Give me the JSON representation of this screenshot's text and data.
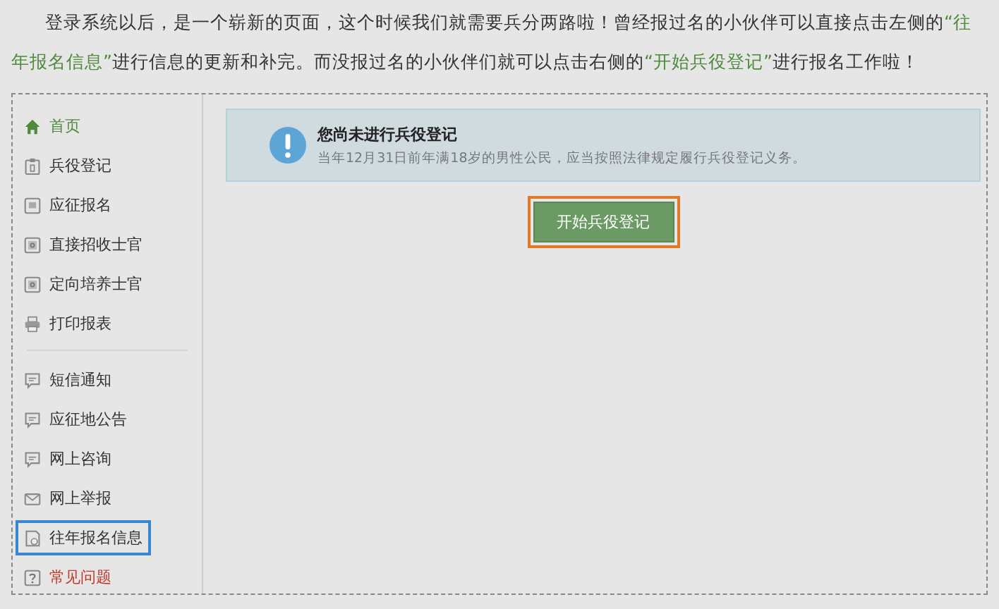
{
  "intro": [
    {
      "text": "登录系统以后，是一个崭新的页面，这个时候我们就需要兵分两路啦！曾经报过名的小伙伴可以直接点击左侧的",
      "highlight": false
    },
    {
      "text": "“往年报名信息”",
      "highlight": true
    },
    {
      "text": "进行信息的更新和补完。而没报过名的小伙伴们就可以点击右侧的",
      "highlight": false
    },
    {
      "text": "“开始兵役登记”",
      "highlight": true
    },
    {
      "text": "进行报名工作啦！",
      "highlight": false
    }
  ],
  "sidebar": {
    "groups": [
      {
        "items": [
          {
            "label": "首页",
            "kind": "home",
            "color": "#4f8a3c",
            "outlined": false
          },
          {
            "label": "兵役登记",
            "kind": "clipboard",
            "color": "#333333",
            "outlined": false
          },
          {
            "label": "应征报名",
            "kind": "form",
            "color": "#333333",
            "outlined": false
          },
          {
            "label": "直接招收士官",
            "kind": "badge",
            "color": "#333333",
            "outlined": false
          },
          {
            "label": "定向培养士官",
            "kind": "badge",
            "color": "#333333",
            "outlined": false
          },
          {
            "label": "打印报表",
            "kind": "printer",
            "color": "#333333",
            "outlined": false
          }
        ]
      },
      {
        "items": [
          {
            "label": "短信通知",
            "kind": "chat",
            "color": "#333333",
            "outlined": false
          },
          {
            "label": "应征地公告",
            "kind": "chat",
            "color": "#333333",
            "outlined": false
          },
          {
            "label": "网上咨询",
            "kind": "chat",
            "color": "#333333",
            "outlined": false
          },
          {
            "label": "网上举报",
            "kind": "mail",
            "color": "#333333",
            "outlined": false
          },
          {
            "label": "往年报名信息",
            "kind": "history",
            "color": "#333333",
            "outlined": true
          },
          {
            "label": "常见问题",
            "kind": "help",
            "color": "#c0392b",
            "outlined": false
          }
        ]
      }
    ]
  },
  "notice": {
    "title": "您尚未进行兵役登记",
    "text": "当年12月31日前年满18岁的男性公民，应当按照法律规定履行兵役登记义务。"
  },
  "start_button": {
    "label": "开始兵役登记",
    "outlined": true
  }
}
